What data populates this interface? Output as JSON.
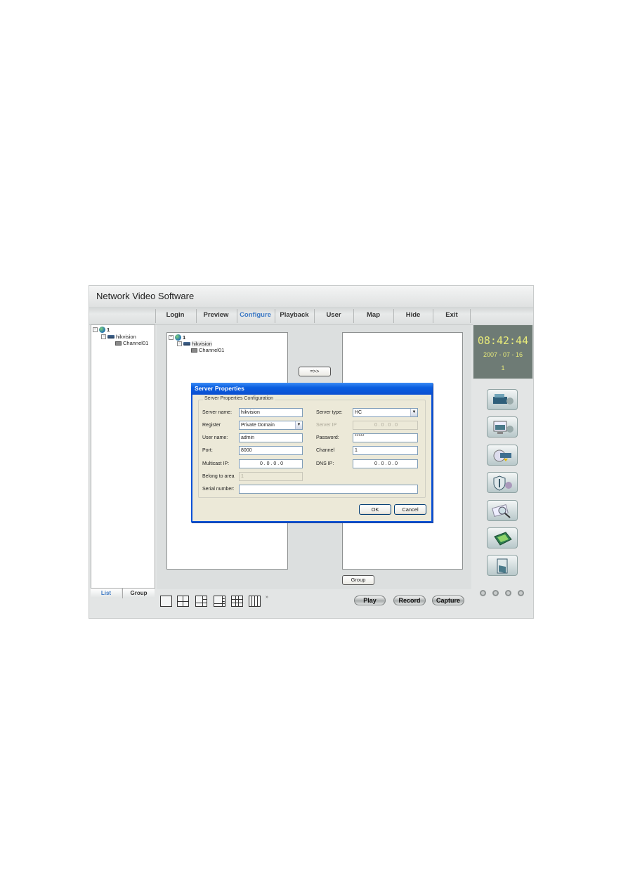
{
  "app": {
    "title": "Network Video Software"
  },
  "menu": [
    {
      "label": "Login",
      "active": false
    },
    {
      "label": "Preview",
      "active": false
    },
    {
      "label": "Configure",
      "active": true
    },
    {
      "label": "Playback",
      "active": false
    },
    {
      "label": "User",
      "active": false
    },
    {
      "label": "Map",
      "active": false
    },
    {
      "label": "Hide",
      "active": false
    },
    {
      "label": "Exit",
      "active": false
    }
  ],
  "tree": {
    "root": {
      "label": "1",
      "icon": "globe-icon",
      "expander": "⊟"
    },
    "server": {
      "label": "hikvision",
      "icon": "dvr-icon",
      "expander": "⊟"
    },
    "channel": {
      "label": "Channel01",
      "icon": "camera-icon"
    }
  },
  "transfer_button": "=>>",
  "group_button": "Group",
  "clock": {
    "time": "08:42:44",
    "date": "2007 - 07 - 16",
    "number": "1"
  },
  "side_buttons": [
    {
      "name": "device-config",
      "icon": "server-gear-icon"
    },
    {
      "name": "local-config",
      "icon": "monitor-gear-icon"
    },
    {
      "name": "remote-config",
      "icon": "disk-transfer-icon"
    },
    {
      "name": "security-config",
      "icon": "shield-gear-icon"
    },
    {
      "name": "search",
      "icon": "magnifier-icon"
    },
    {
      "name": "map-config",
      "icon": "map-board-icon"
    },
    {
      "name": "exit",
      "icon": "exit-door-icon"
    }
  ],
  "bottom_tabs": [
    {
      "label": "List",
      "active": true
    },
    {
      "label": "Group",
      "active": false
    }
  ],
  "layouts": [
    "1-split",
    "4-split",
    "6-split",
    "8-split",
    "9-split",
    "16-split"
  ],
  "more_layouts": "»",
  "playback_controls": [
    {
      "label": "Play"
    },
    {
      "label": "Record"
    },
    {
      "label": "Capture"
    }
  ],
  "dialog": {
    "title": "Server Properties",
    "group_title": "Server Properties Configuration",
    "fields": {
      "server_name": {
        "label": "Server name:",
        "value": "hikvision"
      },
      "register": {
        "label": "Register",
        "value": "Private Domain"
      },
      "user_name": {
        "label": "User name:",
        "value": "admin"
      },
      "port": {
        "label": "Port:",
        "value": "8000"
      },
      "multicast_ip": {
        "label": "Multicast IP:",
        "value": "0 . 0 . 0 . 0"
      },
      "belong_area": {
        "label": "Belong to area",
        "value": "1"
      },
      "serial_number": {
        "label": "Serial number:",
        "value": ""
      },
      "server_type": {
        "label": "Server type:",
        "value": "HC"
      },
      "server_ip": {
        "label": "Server IP",
        "value": "0 . 0 . 0 . 0"
      },
      "password": {
        "label": "Password:",
        "value": "*****"
      },
      "channel": {
        "label": "Channel",
        "value": "1"
      },
      "dns_ip": {
        "label": "DNS IP:",
        "value": "0 . 0 . 0 . 0"
      }
    },
    "ok": "OK",
    "cancel": "Cancel"
  }
}
